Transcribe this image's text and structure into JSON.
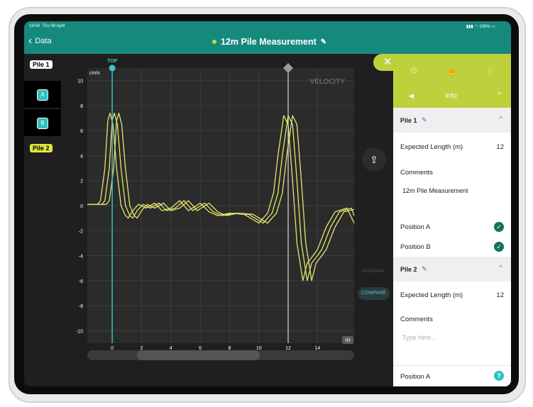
{
  "status": {
    "time": "19:54",
    "date": "Thu 08 April",
    "battery": "100%"
  },
  "nav": {
    "back_label": "Data",
    "title": "12m Pile Measurement"
  },
  "sidebar": {
    "pile1": "Pile 1",
    "pos_a": "A",
    "pos_b": "B",
    "pile2": "Pile 2"
  },
  "chart_data": {
    "type": "line",
    "title": "VELOCITY",
    "ylabel": "cm/s",
    "xunit": "m",
    "marker_label": "TOP",
    "ylim": [
      -11,
      11
    ],
    "xlim": [
      -1.7,
      16.5
    ],
    "yticks": [
      10,
      8,
      6,
      4,
      2,
      0,
      -2,
      -4,
      -6,
      -8,
      -10
    ],
    "xticks": [
      0,
      2,
      4,
      6,
      8,
      10,
      12,
      14
    ],
    "top_marker_x": 0,
    "toe_marker_x": 12,
    "series": [
      {
        "values": [
          [
            -1.7,
            0.1
          ],
          [
            -1.0,
            0.1
          ],
          [
            -0.8,
            0.4
          ],
          [
            -0.5,
            3
          ],
          [
            -0.3,
            6.8
          ],
          [
            -0.15,
            7.4
          ],
          [
            0.05,
            6.5
          ],
          [
            0.3,
            3
          ],
          [
            0.6,
            0
          ],
          [
            0.9,
            -0.8
          ],
          [
            1.1,
            -1.0
          ],
          [
            1.4,
            -0.4
          ],
          [
            1.8,
            0.1
          ],
          [
            2.3,
            -0.2
          ],
          [
            2.9,
            0.2
          ],
          [
            3.4,
            -0.4
          ],
          [
            4.0,
            -0.2
          ],
          [
            4.6,
            0.4
          ],
          [
            5.2,
            -0.4
          ],
          [
            6.0,
            0.2
          ],
          [
            6.6,
            -0.5
          ],
          [
            7.2,
            -0.8
          ],
          [
            8.0,
            -0.6
          ],
          [
            9.0,
            -0.7
          ],
          [
            10.0,
            -1.4
          ],
          [
            10.6,
            -0.6
          ],
          [
            11.0,
            1
          ],
          [
            11.3,
            4
          ],
          [
            11.7,
            7.2
          ],
          [
            12.0,
            6.5
          ],
          [
            12.3,
            2
          ],
          [
            12.6,
            -3
          ],
          [
            13.0,
            -6.0
          ],
          [
            13.3,
            -4.6
          ],
          [
            13.7,
            -4.0
          ],
          [
            14.0,
            -3.5
          ],
          [
            14.6,
            -1.7
          ],
          [
            15.2,
            -0.5
          ],
          [
            16.0,
            -0.2
          ],
          [
            16.5,
            -1.4
          ]
        ]
      },
      {
        "values": [
          [
            -1.7,
            0.1
          ],
          [
            -0.7,
            0.1
          ],
          [
            -0.5,
            0.4
          ],
          [
            -0.2,
            3
          ],
          [
            0.0,
            6.8
          ],
          [
            0.15,
            7.4
          ],
          [
            0.35,
            6.5
          ],
          [
            0.6,
            3
          ],
          [
            0.9,
            0
          ],
          [
            1.2,
            -0.8
          ],
          [
            1.4,
            -1.0
          ],
          [
            1.7,
            -0.4
          ],
          [
            2.1,
            0.1
          ],
          [
            2.6,
            -0.2
          ],
          [
            3.2,
            0.2
          ],
          [
            3.7,
            -0.4
          ],
          [
            4.3,
            -0.2
          ],
          [
            4.9,
            0.4
          ],
          [
            5.5,
            -0.4
          ],
          [
            6.3,
            0.2
          ],
          [
            6.9,
            -0.5
          ],
          [
            7.5,
            -0.8
          ],
          [
            8.3,
            -0.6
          ],
          [
            9.3,
            -0.7
          ],
          [
            10.3,
            -1.4
          ],
          [
            10.9,
            -0.6
          ],
          [
            11.3,
            1
          ],
          [
            11.6,
            4
          ],
          [
            12.0,
            7.2
          ],
          [
            12.3,
            6.5
          ],
          [
            12.6,
            2
          ],
          [
            12.9,
            -3
          ],
          [
            13.3,
            -6.0
          ],
          [
            13.6,
            -4.6
          ],
          [
            14.0,
            -4.0
          ],
          [
            14.3,
            -3.5
          ],
          [
            14.9,
            -1.7
          ],
          [
            15.5,
            -0.5
          ],
          [
            16.3,
            -0.2
          ],
          [
            16.5,
            -0.8
          ]
        ]
      },
      {
        "values": [
          [
            -1.7,
            0.1
          ],
          [
            -0.4,
            0.1
          ],
          [
            -0.2,
            0.4
          ],
          [
            0.1,
            3
          ],
          [
            0.3,
            6.8
          ],
          [
            0.45,
            7.4
          ],
          [
            0.65,
            6.5
          ],
          [
            0.9,
            3
          ],
          [
            1.2,
            0
          ],
          [
            1.5,
            -0.8
          ],
          [
            1.7,
            -1.0
          ],
          [
            2.0,
            -0.4
          ],
          [
            2.4,
            0.1
          ],
          [
            2.9,
            -0.2
          ],
          [
            3.5,
            0.2
          ],
          [
            4.0,
            -0.4
          ],
          [
            4.6,
            -0.2
          ],
          [
            5.2,
            0.4
          ],
          [
            5.8,
            -0.4
          ],
          [
            6.6,
            0.2
          ],
          [
            7.2,
            -0.5
          ],
          [
            7.8,
            -0.8
          ],
          [
            8.6,
            -0.6
          ],
          [
            9.6,
            -0.7
          ],
          [
            10.6,
            -1.4
          ],
          [
            11.2,
            -0.6
          ],
          [
            11.6,
            1
          ],
          [
            11.9,
            4
          ],
          [
            12.3,
            7.2
          ],
          [
            12.6,
            6.5
          ],
          [
            12.9,
            2
          ],
          [
            13.2,
            -3
          ],
          [
            13.6,
            -6.0
          ],
          [
            13.9,
            -4.6
          ],
          [
            14.3,
            -4.0
          ],
          [
            14.6,
            -3.5
          ],
          [
            15.2,
            -1.7
          ],
          [
            15.8,
            -0.5
          ],
          [
            16.5,
            -0.3
          ]
        ]
      }
    ],
    "line_color": "#e3e66c",
    "grid": true
  },
  "buttons": {
    "compare": "COMPARE",
    "seasonal": "SEASONAL"
  },
  "panel": {
    "close": "✕",
    "info_label": "Info",
    "pile1": {
      "title": "Pile 1",
      "expected_label": "Expected Length (m)",
      "expected_value": "12",
      "comments_label": "Comments",
      "comments_value": "12m Pile Measurement",
      "pos_a": "Position A",
      "pos_b": "Position B"
    },
    "pile2": {
      "title": "Pile 2",
      "expected_label": "Expected Length (m)",
      "expected_value": "12",
      "comments_label": "Comments",
      "comments_placeholder": "Type here...",
      "pos_a": "Position A"
    }
  },
  "colors": {
    "accent": "#16897d",
    "panel_accent": "#bcd13c",
    "trace": "#e3e66c",
    "marker": "#3cc6cf",
    "check": "#14725d"
  }
}
